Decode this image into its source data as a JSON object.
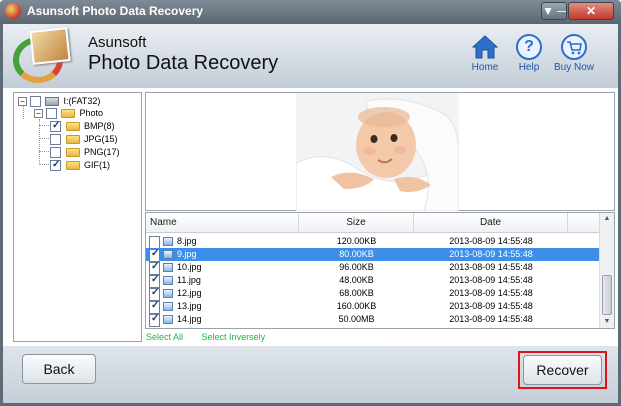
{
  "window": {
    "title": "Asunsoft Photo Data Recovery",
    "min_glyph": "▼ ─",
    "close_glyph": "✕"
  },
  "header": {
    "brand_line1": "Asunsoft",
    "brand_line2": "Photo Data Recovery",
    "buttons": [
      {
        "label": "Home",
        "icon": "home-icon"
      },
      {
        "label": "Help",
        "icon": "help-icon"
      },
      {
        "label": "Buy Now",
        "icon": "cart-icon"
      }
    ]
  },
  "tree": {
    "root": {
      "label": "I:(FAT32)",
      "checked": false
    },
    "photo": {
      "label": "Photo",
      "checked": false
    },
    "children": [
      {
        "label": "BMP(8)",
        "checked": true
      },
      {
        "label": "JPG(15)",
        "checked": false
      },
      {
        "label": "PNG(17)",
        "checked": false
      },
      {
        "label": "GIF(1)",
        "checked": true
      }
    ]
  },
  "list": {
    "columns": {
      "name": "Name",
      "size": "Size",
      "date": "Date"
    },
    "rows": [
      {
        "name": "8.jpg",
        "size": "120.00KB",
        "date": "2013-08-09 14:55:48",
        "checked": false,
        "selected": false
      },
      {
        "name": "9.jpg",
        "size": "80.00KB",
        "date": "2013-08-09 14:55:48",
        "checked": true,
        "selected": true
      },
      {
        "name": "10.jpg",
        "size": "96.00KB",
        "date": "2013-08-09 14:55:48",
        "checked": true,
        "selected": false
      },
      {
        "name": "11.jpg",
        "size": "48.00KB",
        "date": "2013-08-09 14:55:48",
        "checked": true,
        "selected": false
      },
      {
        "name": "12.jpg",
        "size": "68.00KB",
        "date": "2013-08-09 14:55:48",
        "checked": true,
        "selected": false
      },
      {
        "name": "13.jpg",
        "size": "160.00KB",
        "date": "2013-08-09 14:55:48",
        "checked": true,
        "selected": false
      },
      {
        "name": "14.jpg",
        "size": "50.00MB",
        "date": "2013-08-09 14:55:48",
        "checked": true,
        "selected": false
      }
    ]
  },
  "links": {
    "select_all": "Select All",
    "select_inversely": "Select Inversely"
  },
  "footer": {
    "back": "Back",
    "recover": "Recover"
  },
  "colors": {
    "selection": "#3d8ee8",
    "link": "#1db73c",
    "highlight": "#e0131b"
  }
}
